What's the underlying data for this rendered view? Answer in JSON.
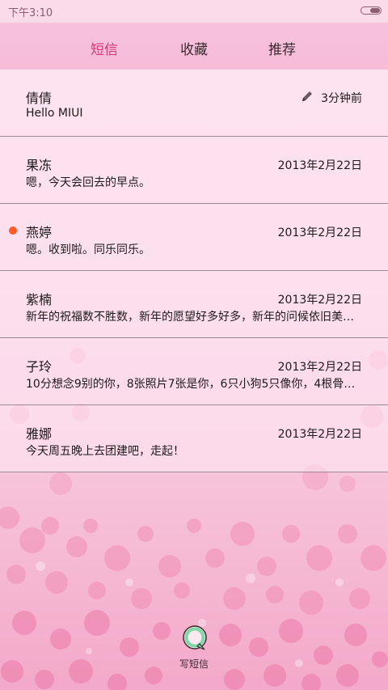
{
  "status_bar": {
    "time": "下午3:10"
  },
  "tabs": [
    {
      "label": "短信",
      "active": true
    },
    {
      "label": "收藏",
      "active": false
    },
    {
      "label": "推荐",
      "active": false
    }
  ],
  "messages": [
    {
      "name": "倩倩",
      "preview": "Hello MIUI",
      "time": "3分钟前",
      "draft": true,
      "unread": false
    },
    {
      "name": "果冻",
      "preview": "嗯，今天会回去的早点。",
      "time": "2013年2月22日",
      "draft": false,
      "unread": false
    },
    {
      "name": "燕婷",
      "preview": "嗯。收到啦。同乐同乐。",
      "time": "2013年2月22日",
      "draft": false,
      "unread": true
    },
    {
      "name": "紫楠",
      "preview": "新年的祝福数不胜数，新年的愿望好多好多，新年的问候依旧美好…",
      "time": "2013年2月22日",
      "draft": false,
      "unread": false
    },
    {
      "name": "子玲",
      "preview": "10分想念9别的你，8张照片7张是你，6只小狗5只像你，4根骨头…",
      "time": "2013年2月22日",
      "draft": false,
      "unread": false
    },
    {
      "name": "雅娜",
      "preview": "今天周五晚上去团建吧，走起！",
      "time": "2013年2月22日",
      "draft": false,
      "unread": false
    }
  ],
  "compose": {
    "label": "写短信",
    "icon": "compose-message-icon"
  },
  "colors": {
    "accent": "#d23a73",
    "unread_dot": "#ff5a2a",
    "compose_ring": "#7fd6a6"
  }
}
